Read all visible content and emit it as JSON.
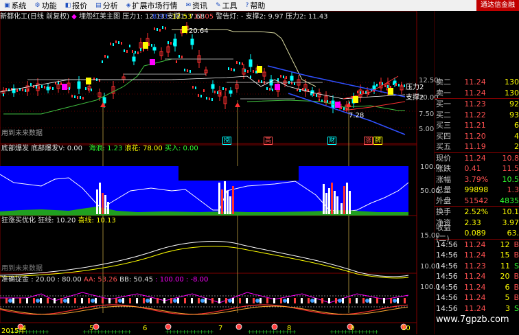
{
  "menu": [
    {
      "label": "系统",
      "icon": "system-icon"
    },
    {
      "label": "功能",
      "icon": "function-icon"
    },
    {
      "label": "报价",
      "icon": "quote-icon"
    },
    {
      "label": "分析",
      "icon": "analysis-icon"
    },
    {
      "label": "扩展市场行情",
      "icon": "market-icon"
    },
    {
      "label": "资讯",
      "icon": "news-icon"
    },
    {
      "label": "工具",
      "icon": "tool-icon"
    },
    {
      "label": "帮助",
      "icon": "help-icon"
    }
  ],
  "brand": "通达信金融",
  "main_header": {
    "title": "新都化工(日线 前复权)",
    "indicator": "埋怨红美主图",
    "pressure": "压力1: 12.13",
    "support": "支撑1: 7.68",
    "v1": "8.93",
    "v2": "12.53",
    "v3": "11.05",
    "warning": "警告灯: -",
    "support2": "支撑2: 9.97",
    "pressure2": "压力2: 11.43",
    "high_label": "20.64",
    "low_label": "7.28",
    "future": "用到未来数据",
    "right_pressure": "压力2",
    "right_support": "支撑2"
  },
  "main_axis": [
    "12.50",
    "10.00",
    "7.50",
    "5.00"
  ],
  "sub1_header": {
    "name": "底部爆发",
    "v": "底部爆发V: 0.00",
    "a": "海浪: 1.23",
    "b": "浪花: 78.00",
    "c": "买入: 0.00"
  },
  "sub1_axis": [
    "100.0",
    "50.00"
  ],
  "sub2_header": {
    "name": "狂涨买优化",
    "a": "狂线: 10.20",
    "b": "喜线: 10.13",
    "future": "用到未来数据"
  },
  "sub2_axis": [
    "15.00",
    "10.00"
  ],
  "sub3_header": {
    "name": "准确捉金",
    "a": ": 20.00",
    "b": ": 80.00",
    "c": "AA: 53.26",
    "d": "BB: 50.45",
    "e": ": 100.00",
    "f": ": -8.00"
  },
  "sub3_axis": [
    "100.0"
  ],
  "signals": [
    {
      "text": "捌",
      "color": "#00ffff"
    },
    {
      "text": "高",
      "color": "#ff5050"
    },
    {
      "text": "财",
      "color": "#00ffff"
    },
    {
      "text": "涨",
      "color": "#ff5050"
    },
    {
      "text": "牌",
      "color": "#ffff00"
    }
  ],
  "dates": [
    "2015年",
    "4",
    "5",
    "6",
    "7",
    "8",
    "9",
    "10"
  ],
  "quote_book": [
    {
      "label": "卖二",
      "price": "11.24",
      "vol": "130",
      "pc": "red",
      "vc": "yel"
    },
    {
      "label": "卖一",
      "price": "11.24",
      "vol": "130",
      "pc": "red",
      "vc": "yel"
    },
    {
      "label": "买一",
      "price": "11.23",
      "vol": "92",
      "pc": "red",
      "vc": "yel"
    },
    {
      "label": "买二",
      "price": "11.22",
      "vol": "93",
      "pc": "red",
      "vc": "yel"
    },
    {
      "label": "买三",
      "price": "11.21",
      "vol": "6",
      "pc": "red",
      "vc": "yel"
    },
    {
      "label": "买四",
      "price": "11.20",
      "vol": "4",
      "pc": "red",
      "vc": "yel"
    },
    {
      "label": "买五",
      "price": "11.19",
      "vol": "2",
      "pc": "red",
      "vc": "yel"
    }
  ],
  "stats": [
    {
      "l1": "现价",
      "v1": "11.24",
      "c1": "red",
      "l2": "今开",
      "v2": "10.8",
      "c2": "red"
    },
    {
      "l1": "涨跌",
      "v1": "0.41",
      "c1": "red",
      "l2": "最高",
      "v2": "11.5",
      "c2": "red"
    },
    {
      "l1": "涨幅",
      "v1": "3.79%",
      "c1": "red",
      "l2": "最低",
      "v2": "10.5",
      "c2": "grn"
    },
    {
      "l1": "总量",
      "v1": "99898",
      "c1": "yel",
      "l2": "量比",
      "v2": "1.3",
      "c2": "red"
    },
    {
      "l1": "外盘",
      "v1": "51542",
      "c1": "red",
      "l2": "内盘",
      "v2": "4835",
      "c2": "grn"
    }
  ],
  "stats2": [
    {
      "l1": "换手",
      "v1": "2.52%",
      "c1": "yel",
      "l2": "股本",
      "v2": "10.1",
      "c2": "yel"
    },
    {
      "l1": "净资",
      "v1": "2.33",
      "c1": "yel",
      "l2": "流通",
      "v2": "3.97",
      "c2": "yel"
    },
    {
      "l1": "收益(二)",
      "v1": "0.089",
      "c1": "yel",
      "l2": "PE(动)",
      "v2": "63.",
      "c2": "yel"
    }
  ],
  "ticks": [
    {
      "time": "14:56",
      "price": "11.24",
      "vol": "12",
      "side": "B",
      "pc": "red",
      "vc": "yel",
      "sc": "red"
    },
    {
      "time": "14:56",
      "price": "11.24",
      "vol": "15",
      "side": "B",
      "pc": "red",
      "vc": "yel",
      "sc": "red"
    },
    {
      "time": "14:56",
      "price": "11.23",
      "vol": "11",
      "side": "S",
      "pc": "red",
      "vc": "yel",
      "sc": "grn"
    },
    {
      "time": "14:56",
      "price": "11.24",
      "vol": "20",
      "side": "B",
      "pc": "red",
      "vc": "yel",
      "sc": "red"
    },
    {
      "time": "14:56",
      "price": "11.24",
      "vol": "6",
      "side": "B",
      "pc": "red",
      "vc": "yel",
      "sc": "red"
    },
    {
      "time": "14:56",
      "price": "11.24",
      "vol": "5",
      "side": "B",
      "pc": "red",
      "vc": "yel",
      "sc": "red"
    },
    {
      "time": "14:56",
      "price": "11.24",
      "vol": "3",
      "side": "S",
      "pc": "red",
      "vc": "yel",
      "sc": "grn"
    }
  ],
  "watermark": "www.7gpzb.com",
  "colors": {
    "up": "#ff3030",
    "down": "#00ffff",
    "ma_yellow": "#ffff00",
    "blue_fill": "#0000ff",
    "magenta": "#ff00ff"
  }
}
